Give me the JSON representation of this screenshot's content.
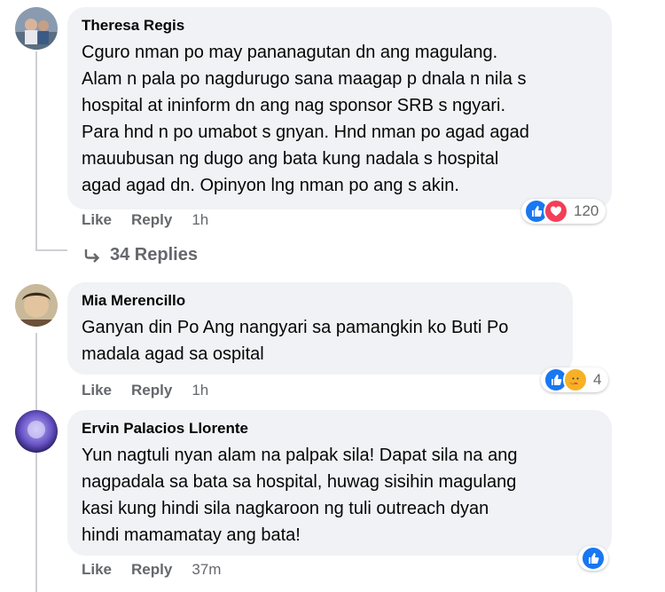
{
  "comments": [
    {
      "author": "Theresa Regis",
      "lines": [
        "Cguro nman po may pananagutan dn ang magulang.",
        "Alam n pala po nagdurugo sana maagap p dnala n nila s",
        "hospital at ininform dn ang nag sponsor SRB s ngyari.",
        "Para hnd n po umabot s gnyan. Hnd nman po agad agad",
        "mauubusan ng dugo ang bata kung nadala s hospital",
        "agad agad dn. Opinyon lng nman po ang s akin."
      ],
      "like": "Like",
      "reply": "Reply",
      "time": "1h",
      "reactions": [
        "like-icon",
        "love-icon"
      ],
      "reaction_count": "120",
      "replies_label": "34 Replies"
    },
    {
      "author": "Mia Merencillo",
      "lines": [
        "Ganyan din Po Ang nangyari sa pamangkin ko Buti Po",
        "madala agad sa ospital"
      ],
      "like": "Like",
      "reply": "Reply",
      "time": "1h",
      "reactions": [
        "like-icon",
        "care-icon"
      ],
      "reaction_count": "4"
    },
    {
      "author": "Ervin Palacios Llorente",
      "lines": [
        "Yun nagtuli nyan alam na palpak sila! Dapat sila na ang",
        "nagpadala sa bata sa hospital, huwag sisihin magulang",
        "kasi kung hindi sila nagkaroon ng tuli outreach dyan",
        "hindi mamamatay ang bata!"
      ],
      "like": "Like",
      "reply": "Reply",
      "time": "37m",
      "reactions": [
        "like-icon"
      ]
    }
  ],
  "colors": {
    "bubble": "#f0f2f5",
    "secondary_text": "#65676b",
    "like_blue": "#1877f2",
    "love_red": "#f33e58",
    "care_yellow": "#f7b125"
  }
}
